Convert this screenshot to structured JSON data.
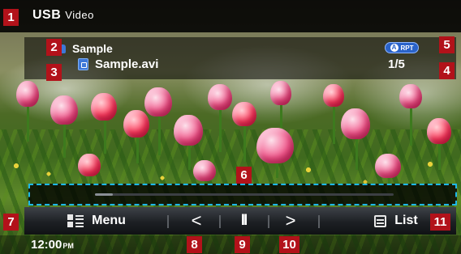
{
  "header": {
    "source": "USB",
    "mode": "Video"
  },
  "file_info": {
    "folder_name": "Sample",
    "file_name": "Sample.avi",
    "track_counter": "1/5",
    "repeat_badge": {
      "letter": "A",
      "label": "RPT",
      "color": "#2a63c9"
    }
  },
  "progress": {
    "fraction": 0.06
  },
  "controls": {
    "menu_label": "Menu",
    "prev_symbol": "<",
    "pause_symbol": "II",
    "next_symbol": ">",
    "list_label": "List"
  },
  "clock": {
    "time": "12:00",
    "ampm": "PM"
  },
  "callouts": [
    "1",
    "2",
    "3",
    "4",
    "5",
    "6",
    "7",
    "8",
    "9",
    "10",
    "11"
  ],
  "colors": {
    "callout": "#b2121a",
    "highlight": "#1eb7e8"
  },
  "icons": {
    "folder": "folder-icon",
    "file": "video-file-icon",
    "menu": "menu-grid-icon",
    "list": "list-icon"
  }
}
